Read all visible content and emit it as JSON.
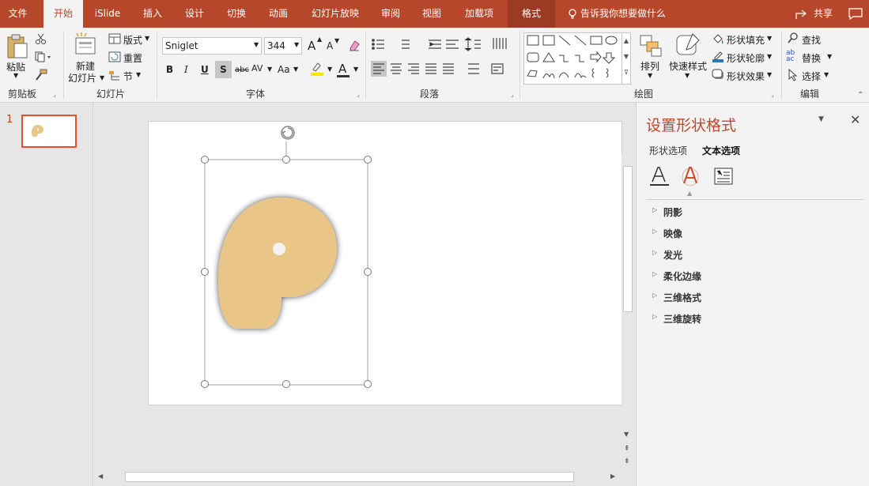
{
  "tabs": [
    {
      "label": "文件"
    },
    {
      "label": "开始"
    },
    {
      "label": "iSlide"
    },
    {
      "label": "插入"
    },
    {
      "label": "设计"
    },
    {
      "label": "切换"
    },
    {
      "label": "动画"
    },
    {
      "label": "幻灯片放映"
    },
    {
      "label": "审阅"
    },
    {
      "label": "视图"
    },
    {
      "label": "加载项"
    },
    {
      "label": "格式"
    }
  ],
  "tellme": "告诉我你想要做什么",
  "share": "共享",
  "clipboard": {
    "paste": "粘贴",
    "label": "剪贴板"
  },
  "slides": {
    "new_line1": "新建",
    "new_line2": "幻灯片",
    "layout": "版式",
    "reset": "重置",
    "section": "节",
    "label": "幻灯片"
  },
  "font": {
    "name": "Sniglet",
    "size": "344",
    "bold": "B",
    "italic": "I",
    "underline": "U",
    "shadow": "S",
    "strike": "abc",
    "spacing": "AV",
    "case": "Aa",
    "color_a": "A",
    "grow": "A",
    "shrink": "A",
    "label": "字体"
  },
  "paragraph": {
    "label": "段落"
  },
  "drawing": {
    "arrange": "排列",
    "quick_styles": "快速样式",
    "fill": "形状填充",
    "outline": "形状轮廓",
    "effects": "形状效果",
    "label": "绘图"
  },
  "editing": {
    "find": "查找",
    "replace": "替换",
    "select": "选择",
    "label": "编辑"
  },
  "thumb": {
    "number": "1"
  },
  "pane": {
    "title": "设置形状格式",
    "tab_shape": "形状选项",
    "tab_text": "文本选项",
    "sections": [
      "阴影",
      "映像",
      "发光",
      "柔化边缘",
      "三维格式",
      "三维旋转"
    ]
  },
  "colors": {
    "accent": "#b7472a",
    "shape": "#e9c587"
  }
}
